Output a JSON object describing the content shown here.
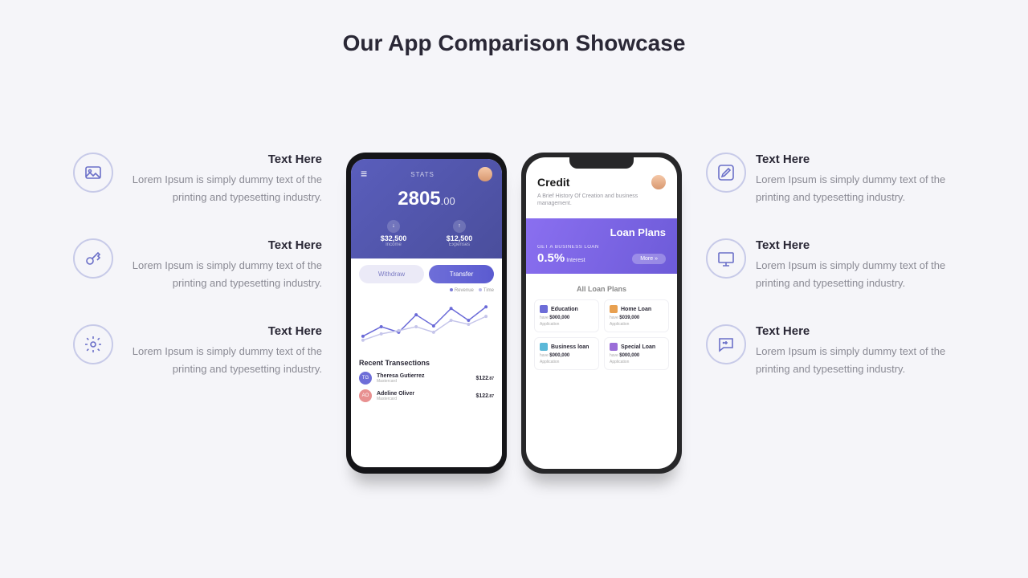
{
  "title": "Our App Comparison Showcase",
  "features_left": [
    {
      "title": "Text Here",
      "desc": "Lorem Ipsum is simply dummy text of the printing and typesetting industry.",
      "icon": "image"
    },
    {
      "title": "Text Here",
      "desc": "Lorem Ipsum is simply dummy text of the printing and typesetting industry.",
      "icon": "key"
    },
    {
      "title": "Text Here",
      "desc": "Lorem Ipsum is simply dummy text of the printing and typesetting industry.",
      "icon": "gear"
    }
  ],
  "features_right": [
    {
      "title": "Text Here",
      "desc": "Lorem Ipsum is simply dummy text of the printing and typesetting industry.",
      "icon": "edit"
    },
    {
      "title": "Text Here",
      "desc": "Lorem Ipsum is simply dummy text of the printing and typesetting industry.",
      "icon": "monitor"
    },
    {
      "title": "Text Here",
      "desc": "Lorem Ipsum is simply dummy text of the printing and typesetting industry.",
      "icon": "chat"
    }
  ],
  "phone1": {
    "stats_label": "STATS",
    "balance_main": "2805",
    "balance_dec": ".00",
    "income": {
      "value": "$32,500",
      "label": "Income"
    },
    "expenses": {
      "value": "$12,500",
      "label": "Expenses"
    },
    "btn_withdraw": "Withdraw",
    "btn_transfer": "Transfer",
    "legend": {
      "a": "Revenue",
      "b": "Time"
    },
    "recent_title": "Recent Transections",
    "transactions": [
      {
        "initials": "TG",
        "name": "Theresa Gutierrez",
        "sub": "Mastercard",
        "amount": "$122",
        "cents": ".87"
      },
      {
        "initials": "AO",
        "name": "Adeline Oliver",
        "sub": "Mastercard",
        "amount": "$122",
        "cents": ".87"
      }
    ]
  },
  "phone2": {
    "title": "Credit",
    "subtitle": "A Brief History Of Creation and business management.",
    "banner_title": "Loan Plans",
    "banner_label": "GET A BUSINESS LOAN",
    "rate": "0.5%",
    "rate_label": "Interest",
    "more": "More »",
    "all_plans": "All Loan Plans",
    "cards": [
      {
        "title": "Education",
        "amount": "$000,000",
        "action": "Application"
      },
      {
        "title": "Home Loan",
        "amount": "$039,000",
        "action": "Application"
      },
      {
        "title": "Business loan",
        "amount": "$000,000",
        "action": "Application"
      },
      {
        "title": "Special Loan",
        "amount": "$000,000",
        "action": "Application"
      }
    ],
    "card_prefix": "have"
  },
  "chart_data": {
    "type": "line",
    "x": [
      1,
      2,
      3,
      4,
      5,
      6,
      7,
      8
    ],
    "series": [
      {
        "name": "Revenue",
        "values": [
          30,
          45,
          35,
          60,
          45,
          70,
          55,
          75
        ]
      },
      {
        "name": "Time",
        "values": [
          25,
          35,
          40,
          45,
          38,
          55,
          48,
          60
        ]
      }
    ],
    "xlabel": "",
    "ylabel": "",
    "ylim": [
      0,
      100
    ]
  }
}
